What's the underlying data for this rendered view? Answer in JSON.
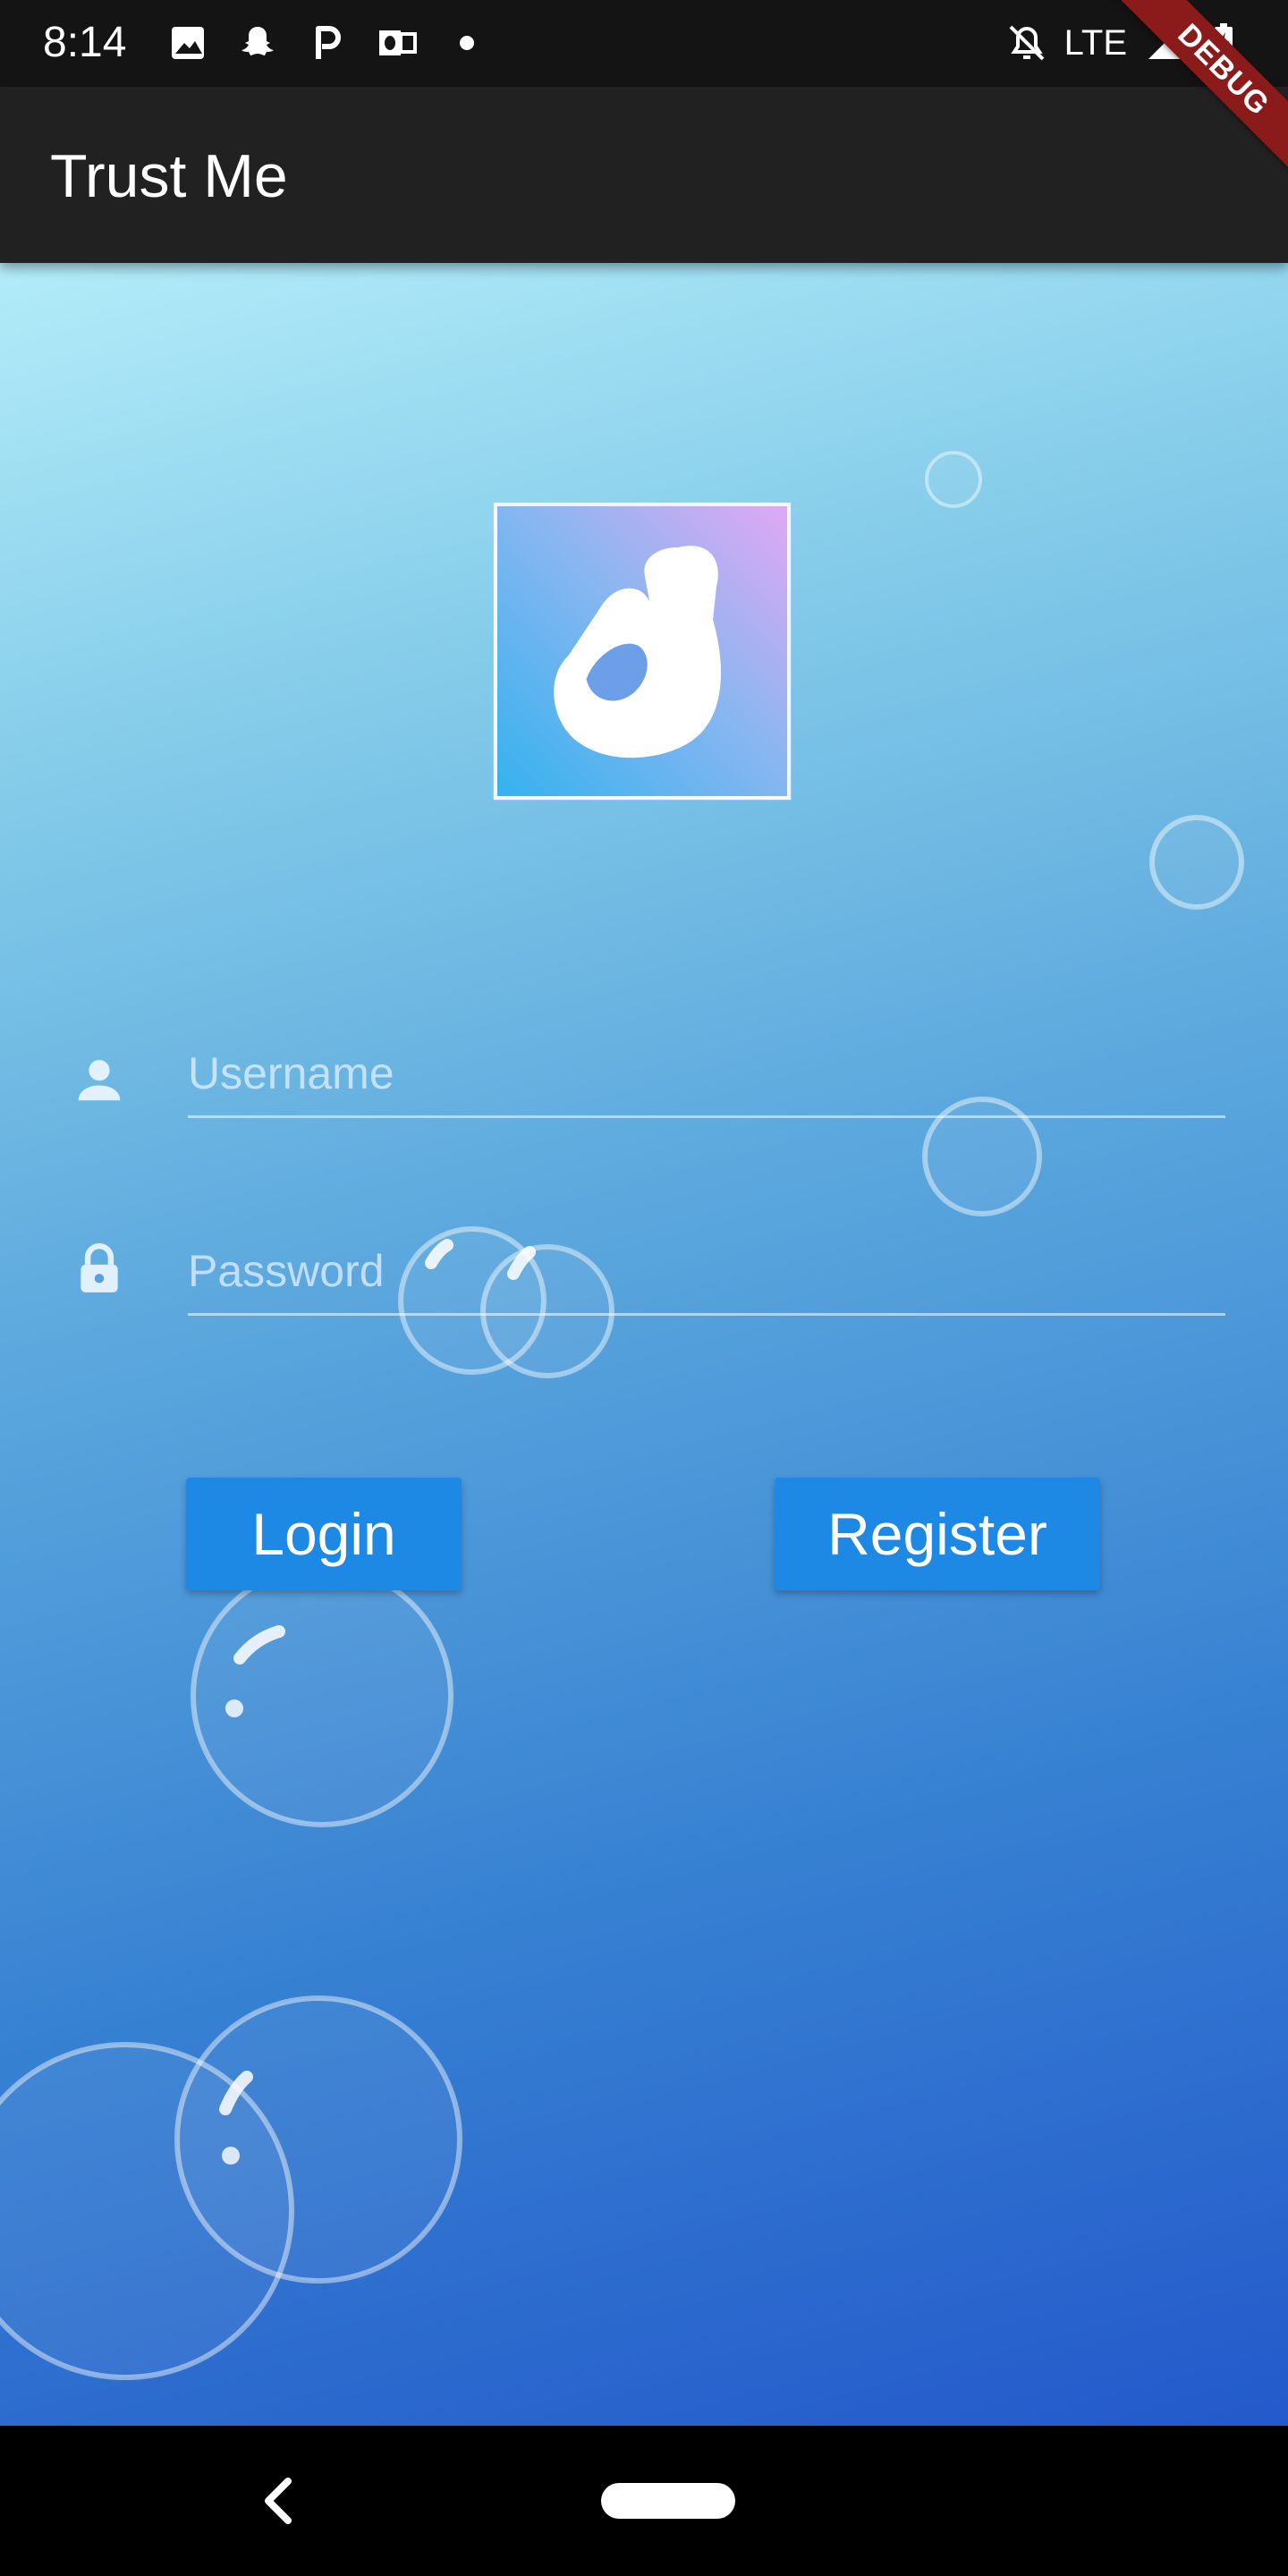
{
  "status_bar": {
    "time": "8:14",
    "network": "LTE",
    "icons_left": [
      "image-icon",
      "snapchat-icon",
      "p-app-icon",
      "outlook-icon",
      "dot-icon"
    ],
    "icons_right": [
      "bell-off-icon",
      "signal-icon",
      "battery-charging-icon"
    ]
  },
  "debug_banner": "DEBUG",
  "app_bar": {
    "title": "Trust Me"
  },
  "logo": {
    "icon": "ok-hand-icon"
  },
  "form": {
    "username_placeholder": "Username",
    "password_placeholder": "Password"
  },
  "buttons": {
    "login": "Login",
    "register": "Register"
  },
  "colors": {
    "app_bar": "#212121",
    "button": "#1e88e5",
    "gradient_top": "#b3ecf9",
    "gradient_bottom": "#2459cb"
  }
}
